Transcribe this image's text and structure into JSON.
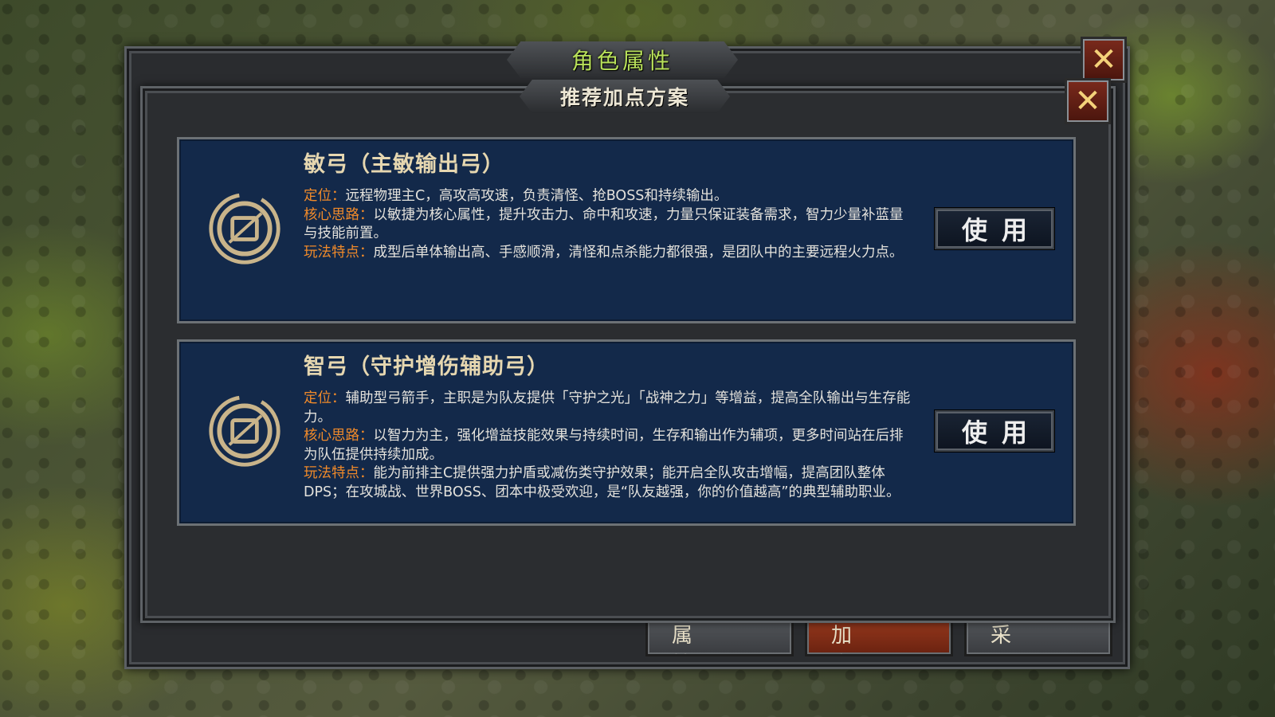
{
  "outer_window": {
    "title": "角色属性",
    "close_symbol": "✕",
    "tabs": [
      "属 性",
      "加 点",
      "采 买"
    ]
  },
  "dialog": {
    "title": "推荐加点方案",
    "close_symbol": "✕"
  },
  "schemes": [
    {
      "name": "敏弓（主敏输出弓）",
      "icon": "bow-class-emblem-icon",
      "position_label": "定位：",
      "position_text": "远程物理主C，高攻高攻速，负责清怪、抢BOSS和持续输出。",
      "core_label": "核心思路：",
      "core_text": "以敏捷为核心属性，提升攻击力、命中和攻速，力量只保证装备需求，智力少量补蓝量与技能前置。",
      "play_label": "玩法特点：",
      "play_text": "成型后单体输出高、手感顺滑，清怪和点杀能力都很强，是团队中的主要远程火力点。",
      "button": "使用"
    },
    {
      "name": "智弓（守护增伤辅助弓）",
      "icon": "bow-class-emblem-icon",
      "position_label": "定位：",
      "position_text": "辅助型弓箭手，主职是为队友提供「守护之光」「战神之力」等增益，提高全队输出与生存能力。",
      "core_label": "核心思路：",
      "core_text": "以智力为主，强化增益技能效果与持续时间，生存和输出作为辅项，更多时间站在后排为队伍提供持续加成。",
      "play_label": "玩法特点：",
      "play_text": "能为前排主C提供强力护盾或减伤类守护效果；能开启全队攻击增幅，提高团队整体DPS；在攻城战、世界BOSS、团本中极受欢迎，是“队友越强，你的价值越高”的典型辅助职业。",
      "button": "使用"
    }
  ],
  "colors": {
    "card_bg": "#13294a",
    "label_orange": "#f08a2a",
    "outer_title_green": "#b8e05a",
    "card_title": "#e6d7b0"
  }
}
